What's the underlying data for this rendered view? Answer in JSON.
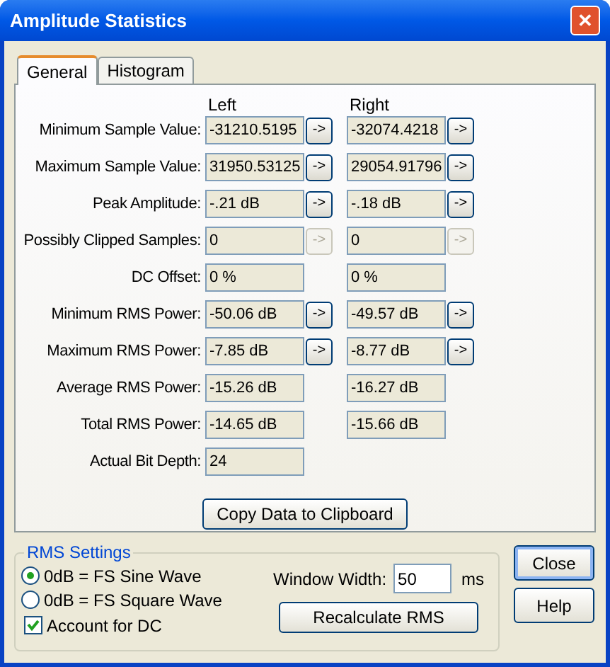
{
  "window": {
    "title": "Amplitude Statistics",
    "close_label": "✕"
  },
  "tabs": [
    {
      "label": "General",
      "selected": true
    },
    {
      "label": "Histogram",
      "selected": false
    }
  ],
  "columns": [
    "Left",
    "Right"
  ],
  "rows": [
    {
      "label": "Minimum Sample Value:",
      "cells": [
        {
          "value": "-31210.5195",
          "jump": {
            "label": "->",
            "disabled": false
          }
        },
        {
          "value": "-32074.4218",
          "jump": {
            "label": "->",
            "disabled": false
          }
        }
      ]
    },
    {
      "label": "Maximum Sample Value:",
      "cells": [
        {
          "value": "31950.53125",
          "jump": {
            "label": "->",
            "disabled": false
          }
        },
        {
          "value": "29054.91796",
          "jump": {
            "label": "->",
            "disabled": false
          }
        }
      ]
    },
    {
      "label": "Peak Amplitude:",
      "cells": [
        {
          "value": "-.21 dB",
          "jump": {
            "label": "->",
            "disabled": false
          }
        },
        {
          "value": "-.18 dB",
          "jump": {
            "label": "->",
            "disabled": false
          }
        }
      ]
    },
    {
      "label": "Possibly Clipped Samples:",
      "cells": [
        {
          "value": "0",
          "jump": {
            "label": "->",
            "disabled": true
          }
        },
        {
          "value": "0",
          "jump": {
            "label": "->",
            "disabled": true
          }
        }
      ]
    },
    {
      "label": "DC Offset:",
      "cells": [
        {
          "value": "0 %"
        },
        {
          "value": "0 %"
        }
      ]
    },
    {
      "label": "Minimum RMS Power:",
      "cells": [
        {
          "value": "-50.06 dB",
          "jump": {
            "label": "->",
            "disabled": false
          }
        },
        {
          "value": "-49.57 dB",
          "jump": {
            "label": "->",
            "disabled": false
          }
        }
      ]
    },
    {
      "label": "Maximum RMS Power:",
      "cells": [
        {
          "value": "-7.85 dB",
          "jump": {
            "label": "->",
            "disabled": false
          }
        },
        {
          "value": "-8.77 dB",
          "jump": {
            "label": "->",
            "disabled": false
          }
        }
      ]
    },
    {
      "label": "Average RMS Power:",
      "cells": [
        {
          "value": "-15.26 dB"
        },
        {
          "value": "-16.27 dB"
        }
      ]
    },
    {
      "label": "Total RMS Power:",
      "cells": [
        {
          "value": "-14.65 dB"
        },
        {
          "value": "-15.66 dB"
        }
      ]
    },
    {
      "label": "Actual Bit Depth:",
      "cells": [
        {
          "value": "24"
        }
      ]
    }
  ],
  "copy_button": "Copy Data to Clipboard",
  "rms_settings": {
    "title": "RMS Settings",
    "options": [
      {
        "label": "0dB = FS Sine Wave",
        "selected": true
      },
      {
        "label": "0dB = FS Square Wave",
        "selected": false
      }
    ],
    "account_for_dc": {
      "label": "Account for DC",
      "checked": true
    },
    "window_width": {
      "label": "Window Width:",
      "value": "50",
      "unit": "ms"
    },
    "recalculate_button": "Recalculate RMS"
  },
  "buttons": [
    {
      "label": "Close",
      "default": true
    },
    {
      "label": "Help",
      "default": false
    }
  ]
}
